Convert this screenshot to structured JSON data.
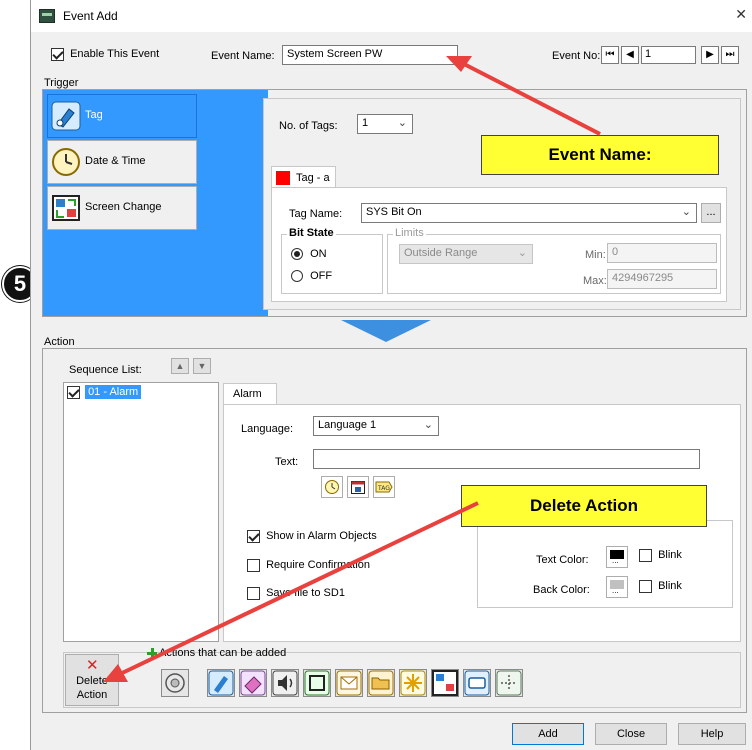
{
  "window": {
    "title": "Event Add",
    "close_glyph": "✕"
  },
  "header": {
    "enable_label": "Enable This Event",
    "enable_checked": true,
    "event_name_label": "Event Name:",
    "event_name_value": "System Screen PW",
    "event_no_label": "Event No:",
    "event_no_value": "1"
  },
  "trigger": {
    "section_label": "Trigger",
    "types": [
      {
        "label": "Tag",
        "icon": "tag-pen-icon",
        "selected": true
      },
      {
        "label": "Date & Time",
        "icon": "clock-icon",
        "selected": false
      },
      {
        "label": "Screen Change",
        "icon": "screen-change-icon",
        "selected": false
      }
    ],
    "no_of_tags_label": "No. of Tags:",
    "no_of_tags_value": "1",
    "tag_tab_label": "Tag - a",
    "tag_name_label": "Tag Name:",
    "tag_name_value": "SYS Bit On",
    "browse_label": "...",
    "bit_state_label": "Bit State",
    "on_label": "ON",
    "off_label": "OFF",
    "limits_label": "Limits",
    "limits_value": "Outside Range",
    "min_label": "Min:",
    "min_value": "0",
    "max_label": "Max:",
    "max_value": "4294967295"
  },
  "annotations": {
    "step_number": "5",
    "event_name_callout": "Event Name:",
    "delete_action_callout": "Delete Action"
  },
  "action": {
    "section_label": "Action",
    "sequence_list_label": "Sequence List:",
    "sequence_items": [
      {
        "label": "01 - Alarm",
        "checked": true,
        "selected": true
      }
    ],
    "detail_tab_label": "Alarm",
    "language_label": "Language:",
    "language_value": "Language 1",
    "text_label": "Text:",
    "text_value": "",
    "show_in_alarm_label": "Show in Alarm Objects",
    "show_in_alarm_checked": true,
    "require_confirmation_label": "Require Confirmation",
    "save_file_label": "Save file to SD1",
    "text_color_label": "Text Color:",
    "text_color_value": "#000000",
    "back_color_label": "Back Color:",
    "back_color_value": "#c0c0c0",
    "blink_label": "Blink",
    "swatch_btn_label": "...",
    "delete_action_line1": "Delete",
    "delete_action_line2": "Action",
    "actions_can_add_label": "Actions that can be added",
    "action_icons": [
      "alarm-bell-icon",
      "tag-pen-icon",
      "eraser-icon",
      "speaker-icon",
      "screen-capture-icon",
      "email-icon",
      "open-folder-icon",
      "flash-icon",
      "screen-change-icon",
      "window-icon",
      "tag-move-icon"
    ]
  },
  "footer": {
    "add_label": "Add",
    "close_label": "Close",
    "help_label": "Help"
  },
  "colors": {
    "selection_blue": "#3399ff",
    "callout_yellow": "#ffff33",
    "arrow_red": "#e8413e",
    "tag_red": "#ff0000"
  }
}
